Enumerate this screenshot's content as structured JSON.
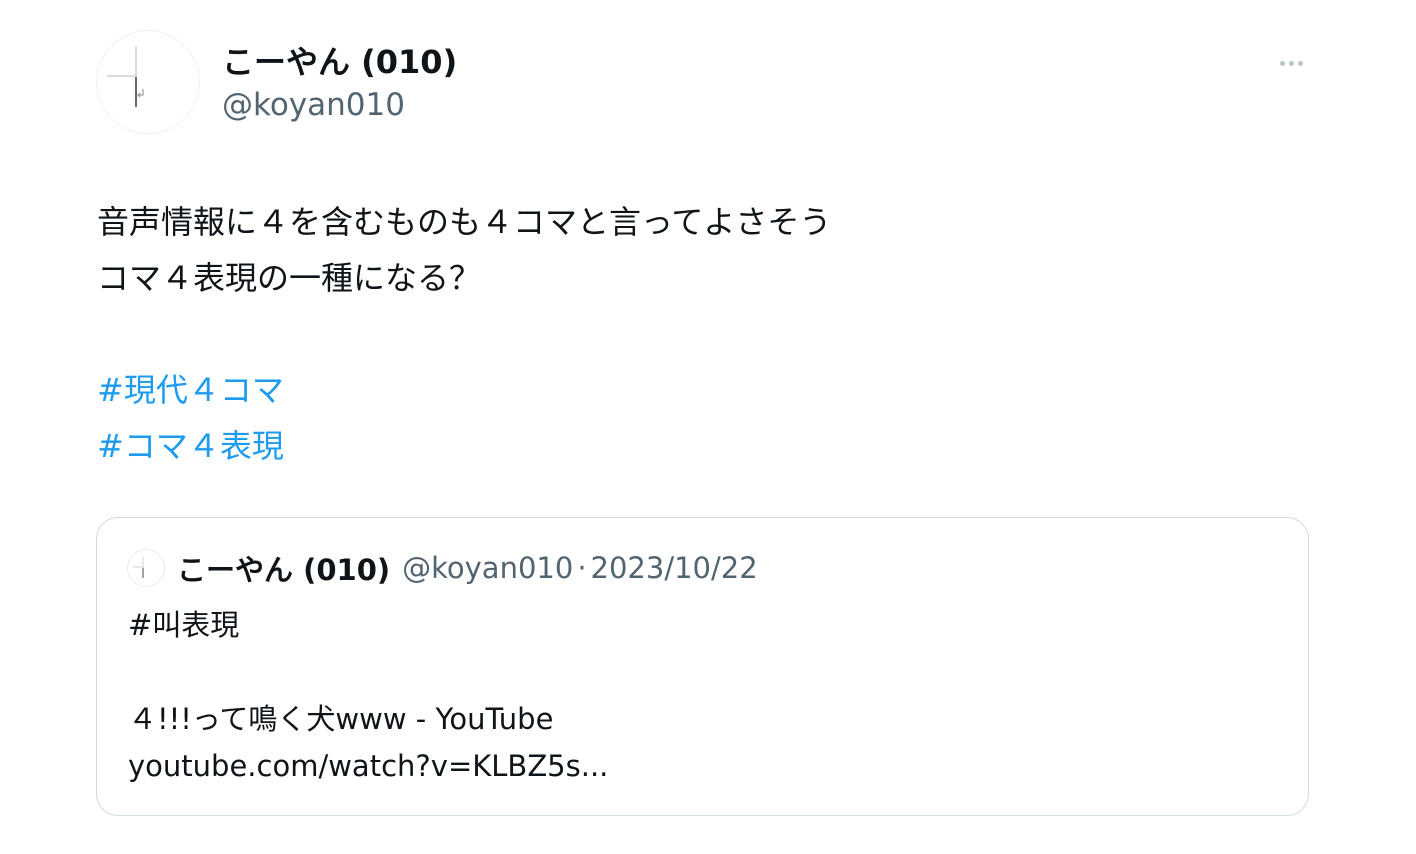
{
  "author": {
    "display_name": "こーやん (010)",
    "handle": "@koyan010"
  },
  "more_icon": "more-horizontal-icon",
  "tweet": {
    "lines": [
      "音声情報に４を含むものも４コマと言ってよさそう",
      "コマ４表現の一種になる？"
    ],
    "hashtags": [
      "#現代４コマ",
      "#コマ４表現"
    ]
  },
  "quoted_tweet": {
    "display_name": "こーやん (010)",
    "handle": "@koyan010",
    "separator": "·",
    "date": "2023/10/22",
    "hashtag": "#叫表現",
    "link_title": "４!!!って鳴く犬www - YouTube",
    "link_url": "youtube.com/watch?v=KLBZ5s..."
  },
  "colors": {
    "text": "#0f1419",
    "secondary": "#536471",
    "link": "#1d9bf0",
    "border": "#cfd9de"
  }
}
